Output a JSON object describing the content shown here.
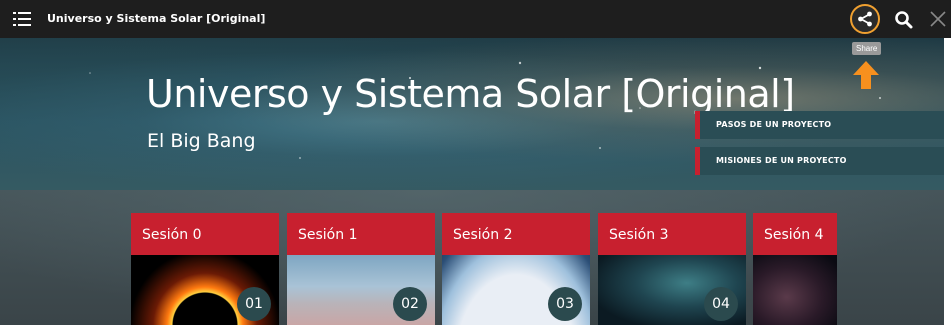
{
  "topbar": {
    "title": "Universo y Sistema Solar [Original]",
    "share_tooltip": "Share"
  },
  "hero": {
    "title": "Universo y Sistema Solar [Original]",
    "subtitle": "El Big Bang"
  },
  "side_links": [
    {
      "label": "PASOS DE UN PROYECTO"
    },
    {
      "label": "MISIONES DE UN PROYECTO"
    }
  ],
  "sessions": [
    {
      "label": "Sesión 0",
      "number": "01"
    },
    {
      "label": "Sesión 1",
      "number": "02"
    },
    {
      "label": "Sesión 2",
      "number": "03"
    },
    {
      "label": "Sesión 3",
      "number": "04"
    },
    {
      "label": "Sesión 4",
      "number": ""
    }
  ],
  "colors": {
    "accent_red": "#c8202f",
    "highlight_orange": "#f0a030",
    "topbar_bg": "#1e1e1e"
  },
  "icons": [
    "menu-icon",
    "share-icon",
    "search-icon",
    "close-icon",
    "arrow-up-icon"
  ]
}
